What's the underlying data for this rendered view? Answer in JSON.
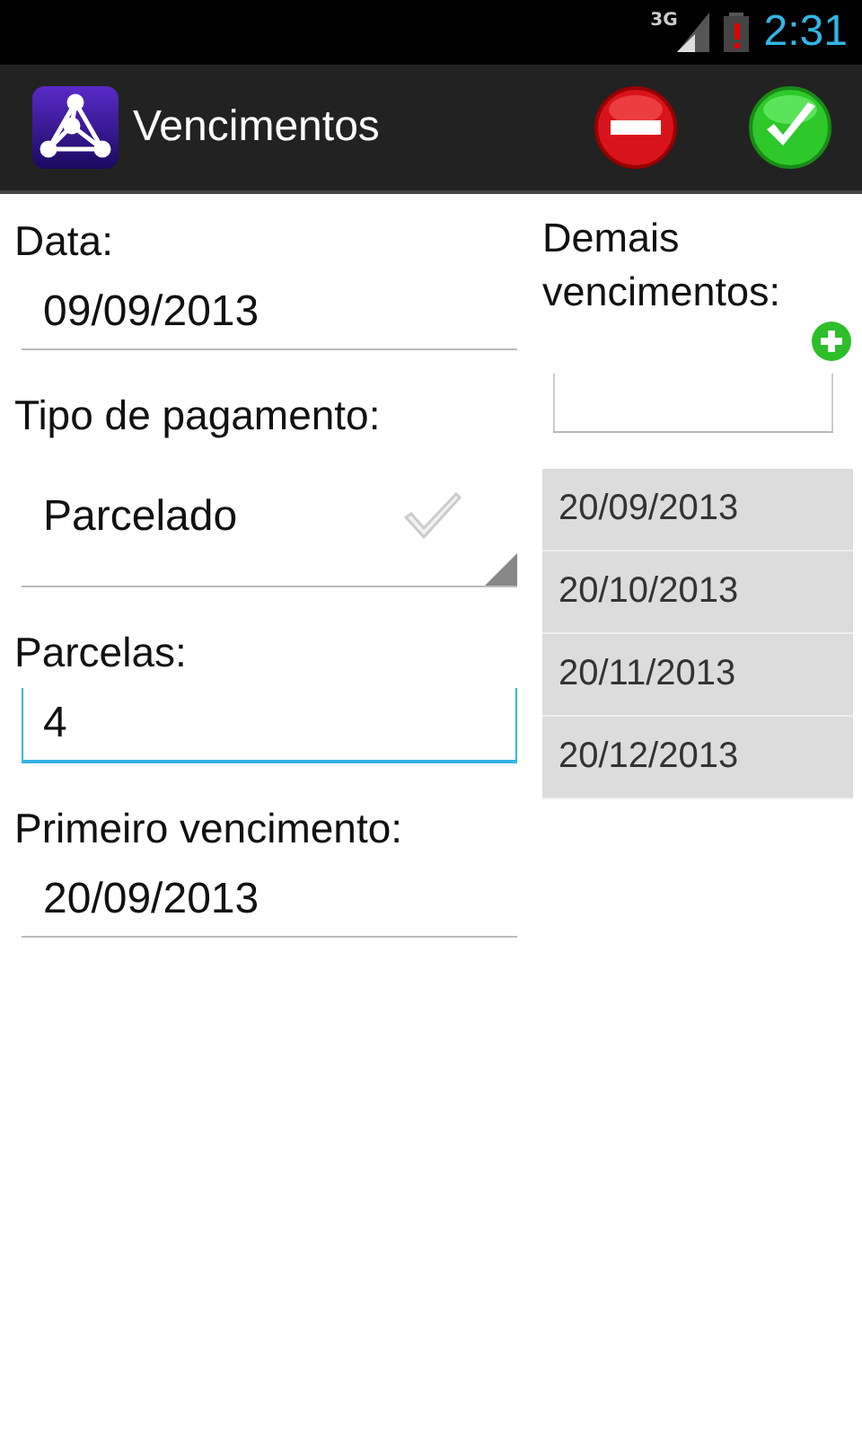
{
  "status_bar": {
    "network": "3G",
    "time": "2:31"
  },
  "action_bar": {
    "title": "Vencimentos"
  },
  "form": [
    {
      "kind": "text",
      "label": "Data:",
      "value": "09/09/2013",
      "focused": false
    },
    {
      "kind": "spinner",
      "label": "Tipo de pagamento:",
      "value": "Parcelado"
    },
    {
      "kind": "text",
      "label": "Parcelas:",
      "value": "4",
      "focused": true
    },
    {
      "kind": "text",
      "label": "Primeiro vencimento:",
      "value": "20/09/2013",
      "focused": false
    }
  ],
  "other_dates": {
    "label": "Demais vencimentos:",
    "items": [
      "20/09/2013",
      "20/10/2013",
      "20/11/2013",
      "20/12/2013"
    ]
  }
}
